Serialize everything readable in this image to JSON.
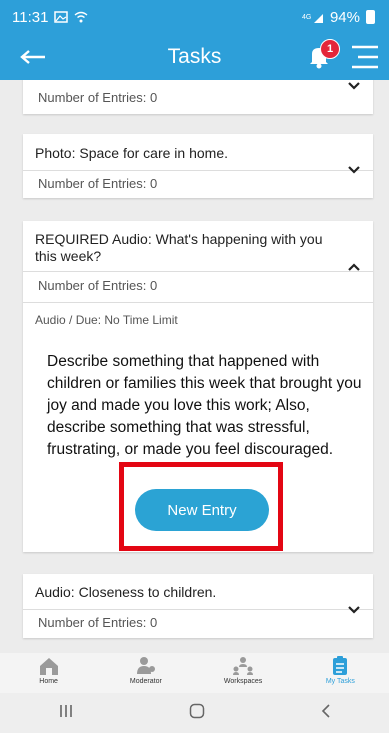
{
  "status_bar": {
    "time": "11:31",
    "battery": "94%"
  },
  "header": {
    "title": "Tasks",
    "notification_count": "1"
  },
  "tasks": [
    {
      "title": "",
      "entries": "Number of Entries: 0"
    },
    {
      "title": "Photo: Space for care in home.",
      "entries": "Number of Entries: 0"
    },
    {
      "title": "REQUIRED Audio: What's happening with you this week?",
      "entries": "Number of Entries: 0",
      "meta": "Audio / Due: No Time Limit",
      "description": "Describe something that happened with children or families this week that brought you joy and made you love this work; Also, describe something that was stressful, frustrating, or made you feel discouraged.",
      "button": "New Entry"
    },
    {
      "title": "Audio: Closeness to children.",
      "entries": "Number of Entries: 0"
    }
  ],
  "bottom_nav": [
    {
      "label": "Home",
      "icon": "home-icon"
    },
    {
      "label": "Moderator",
      "icon": "moderator-icon"
    },
    {
      "label": "Workspaces",
      "icon": "workspaces-icon"
    },
    {
      "label": "My Tasks",
      "icon": "tasks-icon"
    }
  ],
  "colors": {
    "primary": "#2d9fd9",
    "badge": "#e4263a",
    "highlight": "#e30613",
    "button": "#2ba3d4"
  }
}
